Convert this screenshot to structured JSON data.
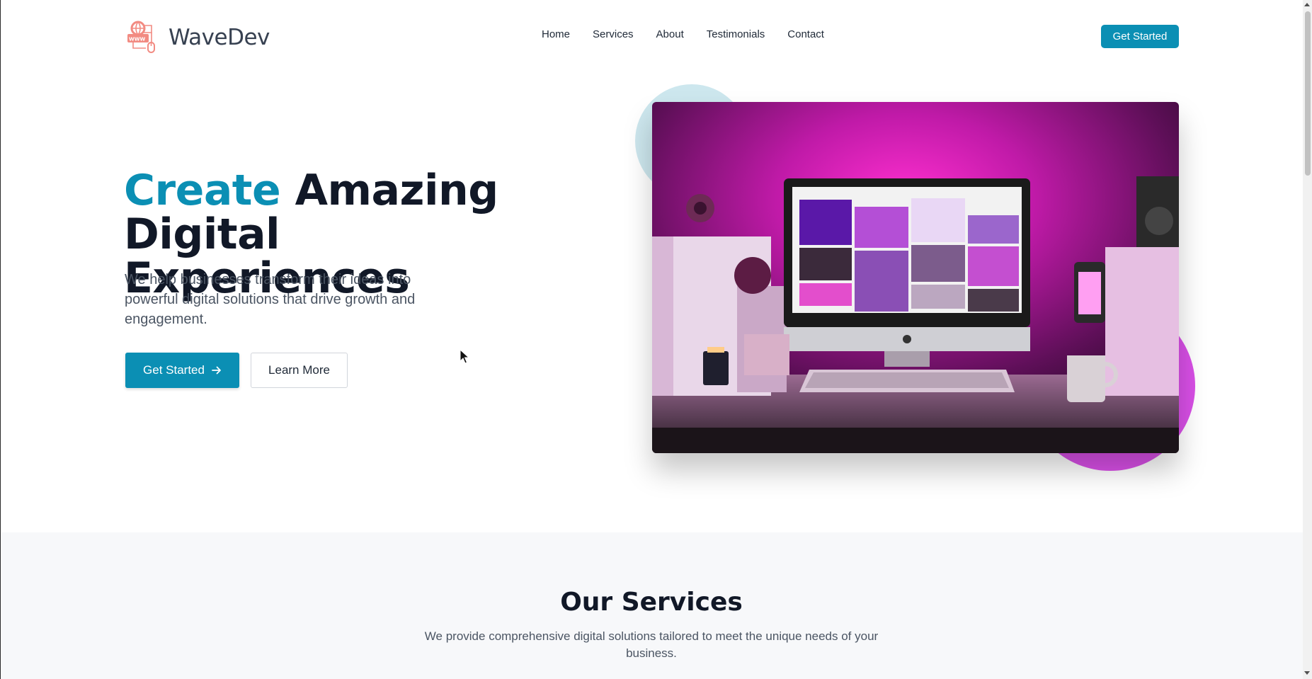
{
  "brand": {
    "name": "WaveDev",
    "logo_icon": "web-network-icon",
    "accent": "#0b8fb4",
    "logo_color": "#f28b82"
  },
  "nav": {
    "items": [
      "Home",
      "Services",
      "About",
      "Testimonials",
      "Contact"
    ]
  },
  "header": {
    "cta_label": "Get Started"
  },
  "hero": {
    "title_accent": "Create",
    "title_rest_1": "Amazing",
    "title_rest_2": "Digital Experiences",
    "subtitle": "We help businesses transform their ideas into powerful digital solutions that drive growth and engagement.",
    "primary_label": "Get Started",
    "primary_icon": "arrow-right-icon",
    "secondary_label": "Learn More",
    "image_subject": "desk-setup-with-computer-and-pink-light"
  },
  "services": {
    "title": "Our Services",
    "subtitle": "We provide comprehensive digital solutions tailored to meet the unique needs of your business."
  }
}
